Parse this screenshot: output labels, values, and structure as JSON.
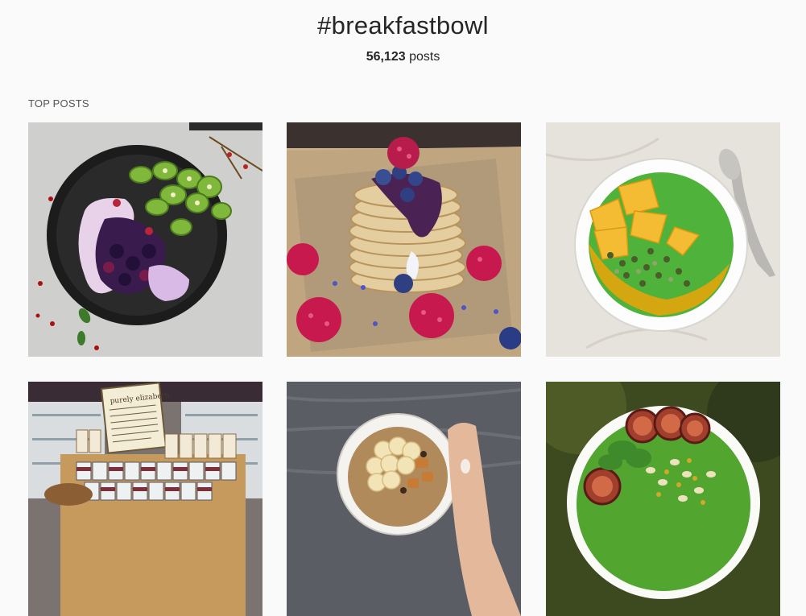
{
  "hashtag": {
    "title": "#breakfastbowl"
  },
  "stats": {
    "count": "56,123",
    "unit": " posts"
  },
  "top_posts": {
    "label": "TOP POSTS"
  },
  "posts": [
    {
      "subject": "berry-yogurt-kiwi-bowl"
    },
    {
      "subject": "pancake-stack-raspberries"
    },
    {
      "subject": "green-smoothie-mango-bowl"
    },
    {
      "subject": "purely-elizabeth-store-display",
      "sign_text": "purely elizabeth."
    },
    {
      "subject": "oatmeal-banana-bowl"
    },
    {
      "subject": "green-smoothie-plum-bowl"
    }
  ]
}
